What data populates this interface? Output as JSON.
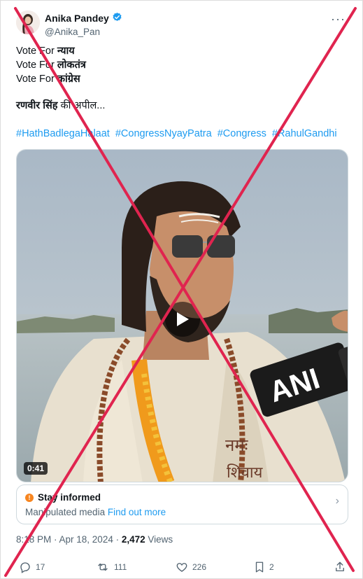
{
  "author": {
    "display_name": "Anika Pandey",
    "handle": "@Anika_Pan",
    "verified_icon": "verified-badge-icon"
  },
  "tweet": {
    "lines": [
      {
        "prefix": "Vote For ",
        "emph": "न्याय"
      },
      {
        "prefix": "Vote For ",
        "emph": "लोकतंत्र"
      },
      {
        "prefix": "Vote For ",
        "emph": "कांग्रेस"
      }
    ],
    "appeal_bold": "रणवीर सिंह",
    "appeal_rest": " की अपील...",
    "hashtags": [
      "#HathBadlegaHalaat",
      "#CongressNyayPatra",
      "#Congress",
      "#RahulGandhi"
    ]
  },
  "media": {
    "duration": "0:41",
    "mic_brand": "ANI",
    "placard_text": "नमः",
    "placard_text2": "शिवाय"
  },
  "note": {
    "title": "Stay informed",
    "body": "Manipulated media",
    "link": "Find out more"
  },
  "meta": {
    "time_date": "8:18 PM · Apr 18, 2024 · ",
    "views_count": "2,472",
    "views_label": " Views"
  },
  "actions": {
    "replies": "17",
    "reposts": "111",
    "likes": "226",
    "bookmarks": "2"
  },
  "colors": {
    "link": "#1d9bf0",
    "cross": "#e0244f",
    "note_icon": "#f7851f"
  }
}
